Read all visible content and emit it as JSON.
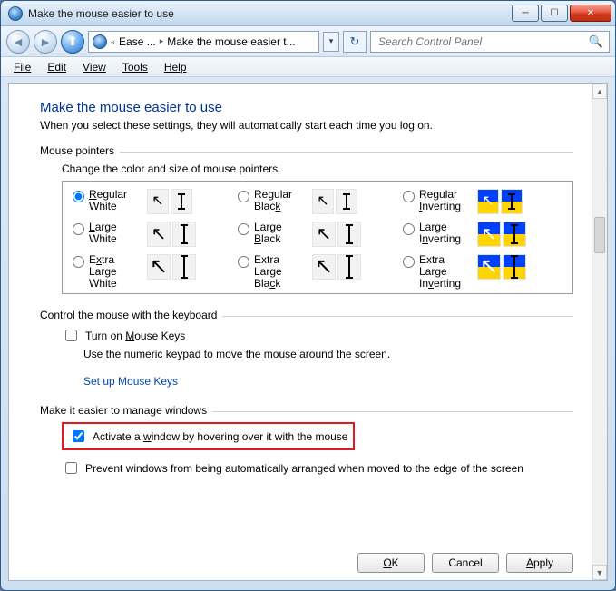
{
  "window": {
    "title": "Make the mouse easier to use"
  },
  "nav": {
    "crumb1": "Ease ...",
    "crumb2": "Make the mouse easier t...",
    "search_placeholder": "Search Control Panel"
  },
  "menu": {
    "file": "File",
    "edit": "Edit",
    "view": "View",
    "tools": "Tools",
    "help": "Help"
  },
  "page": {
    "title": "Make the mouse easier to use",
    "subtitle": "When you select these settings, they will automatically start each time you log on."
  },
  "group1": {
    "label": "Mouse pointers",
    "sub": "Change the color and size of mouse pointers.",
    "options": {
      "o1": "Regular White",
      "o2": "Regular Black",
      "o3": "Regular Inverting",
      "o4": "Large White",
      "o5": "Large Black",
      "o6": "Large Inverting",
      "o7": "Extra Large White",
      "o8": "Extra Large Black",
      "o9": "Extra Large Inverting"
    }
  },
  "group2": {
    "label": "Control the mouse with the keyboard",
    "check": "Turn on Mouse Keys",
    "desc": "Use the numeric keypad to move the mouse around the screen.",
    "link": "Set up Mouse Keys"
  },
  "group3": {
    "label": "Make it easier to manage windows",
    "check1": "Activate a window by hovering over it with the mouse",
    "check2": "Prevent windows from being automatically arranged when moved to the edge of the screen"
  },
  "buttons": {
    "ok": "OK",
    "cancel": "Cancel",
    "apply": "Apply"
  },
  "state": {
    "selected_pointer": "o1",
    "mouse_keys_on": false,
    "activate_hover": true,
    "prevent_arrange": false
  }
}
